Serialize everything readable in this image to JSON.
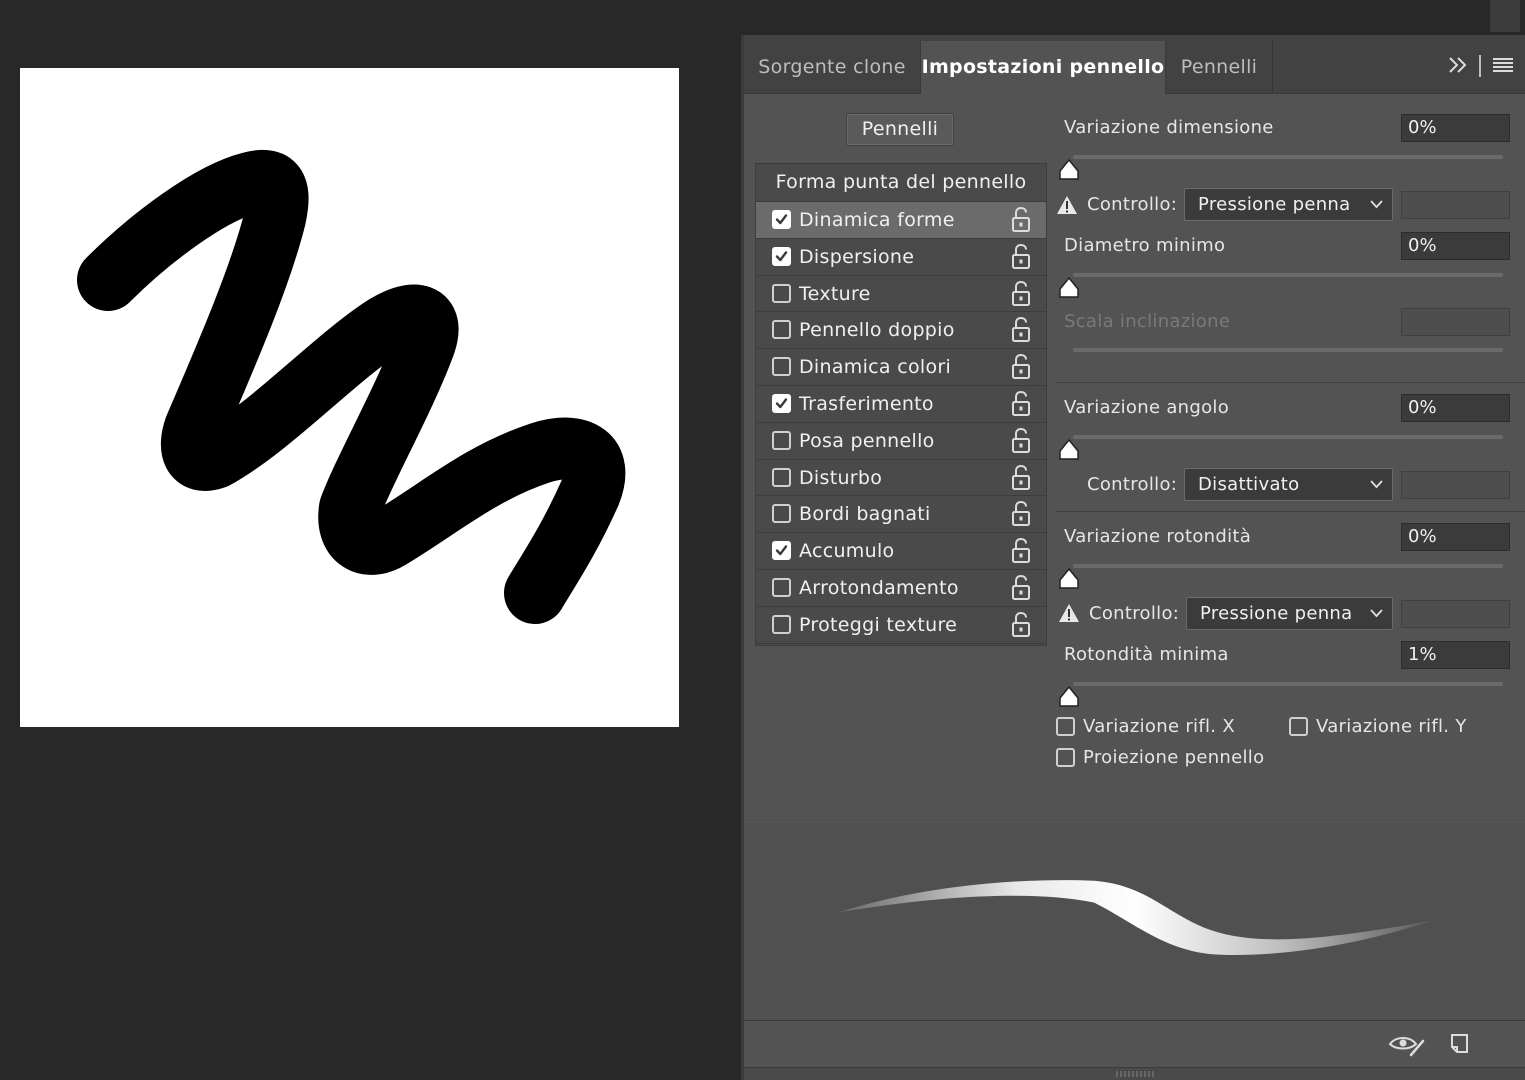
{
  "tabs": {
    "clone_source": "Sorgente clone",
    "brush_settings": "Impostazioni pennello",
    "brushes": "Pennelli"
  },
  "brushes_button": "Pennelli",
  "options": {
    "header": "Forma punta del pennello",
    "items": [
      {
        "label": "Dinamica forme",
        "checked": true,
        "selected": true
      },
      {
        "label": "Dispersione",
        "checked": true
      },
      {
        "label": "Texture",
        "checked": false
      },
      {
        "label": "Pennello doppio",
        "checked": false
      },
      {
        "label": "Dinamica colori",
        "checked": false
      },
      {
        "label": "Trasferimento",
        "checked": true
      },
      {
        "label": "Posa pennello",
        "checked": false
      },
      {
        "label": "Disturbo",
        "checked": false
      },
      {
        "label": "Bordi bagnati",
        "checked": false
      },
      {
        "label": "Accumulo",
        "checked": true
      },
      {
        "label": "Arrotondamento",
        "checked": false
      },
      {
        "label": "Proteggi texture",
        "checked": false
      }
    ]
  },
  "settings": {
    "size_jitter": {
      "label": "Variazione dimensione",
      "value": "0%"
    },
    "size_control": {
      "label": "Controllo:",
      "value": "Pressione penna"
    },
    "min_diameter": {
      "label": "Diametro minimo",
      "value": "0%"
    },
    "tilt_scale": {
      "label": "Scala inclinazione",
      "value": ""
    },
    "angle_jitter": {
      "label": "Variazione angolo",
      "value": "0%"
    },
    "angle_control": {
      "label": "Controllo:",
      "value": "Disattivato"
    },
    "roundness_jitter": {
      "label": "Variazione rotondità",
      "value": "0%"
    },
    "roundness_control": {
      "label": "Controllo:",
      "value": "Pressione penna"
    },
    "min_roundness": {
      "label": "Rotondità minima",
      "value": "1%"
    },
    "flip_x": {
      "label": "Variazione rifl. X",
      "checked": false
    },
    "flip_y": {
      "label": "Variazione rifl. Y",
      "checked": false
    },
    "brush_projection": {
      "label": "Proiezione pennello",
      "checked": false
    }
  },
  "icons": {
    "expand": "double-chevron-right-icon",
    "menu": "panel-menu-icon",
    "lock": "unlock-icon",
    "warning": "warning-icon",
    "eye": "toggle-live-tip-preview-icon",
    "new_preset": "create-new-brush-icon"
  },
  "colors": {
    "panel_bg": "#535353",
    "app_bg": "#282828",
    "canvas": "#ffffff",
    "stroke": "#000000"
  }
}
